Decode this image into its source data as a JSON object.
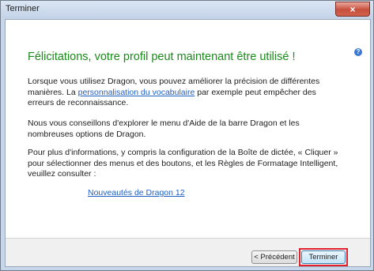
{
  "window": {
    "title": "Terminer",
    "close_glyph": "×"
  },
  "content": {
    "heading": "Félicitations, votre profil peut maintenant être utilisé !",
    "p1_before": "Lorsque vous utilisez Dragon, vous pouvez améliorer la précision de différentes manières. La ",
    "p1_link": "personnalisation du vocabulaire",
    "p1_after": " par exemple peut empêcher des erreurs de reconnaissance.",
    "p2": "Nous vous conseillons d'explorer le menu d'Aide de la barre Dragon et les nombreuses options de Dragon.",
    "p3": "Pour plus d'informations, y compris la configuration de la Boîte de dictée, « Cliquer » pour sélectionner des menus et des boutons, et les Règles de Formatage Intelligent, veuillez consulter :",
    "whats_new_link": "Nouveautés de Dragon 12",
    "help_glyph": "?"
  },
  "buttons": {
    "previous": "< Précédent",
    "finish": "Terminer"
  },
  "colors": {
    "heading": "#1a8a1a",
    "link": "#1f5fc2",
    "highlight": "#e0232e"
  }
}
